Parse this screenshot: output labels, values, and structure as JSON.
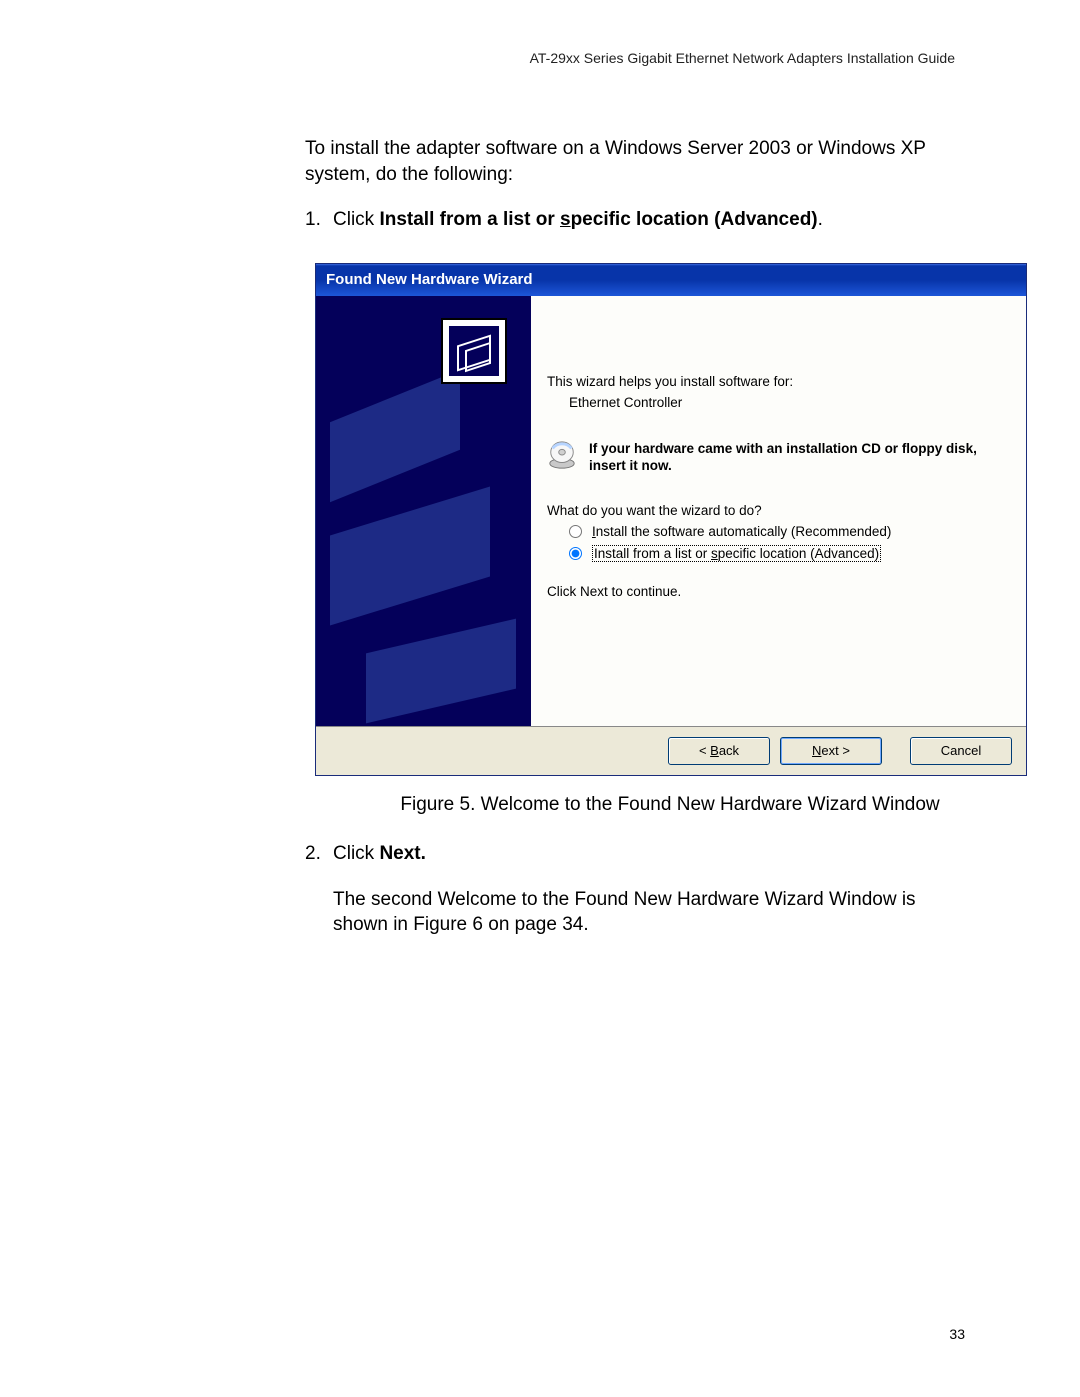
{
  "doc_header": "AT-29xx Series Gigabit Ethernet Network Adapters Installation Guide",
  "intro": "To install the adapter software on a Windows Server 2003 or Windows XP system, do the following:",
  "step1": {
    "num": "1.",
    "prefix": "Click ",
    "bold_a": "Install from a list or ",
    "bold_u": "s",
    "bold_b": "pecific location (Advanced)",
    "suffix": "."
  },
  "dialog": {
    "title": "Found New Hardware Wizard",
    "line1": "This wizard helps you install software for:",
    "device": "Ethernet Controller",
    "cd_text": "If your hardware came with an installation CD or floppy disk, insert it now.",
    "prompt": "What do you want the wizard to do?",
    "radio1_a": "I",
    "radio1_b": "nstall the software automatically (Recommended)",
    "radio2_a": "Install from a list or ",
    "radio2_u": "s",
    "radio2_b": "pecific location (Advanced)",
    "continue": "Click Next to continue.",
    "buttons": {
      "back_lt": "< ",
      "back_u": "B",
      "back_rest": "ack",
      "next_u": "N",
      "next_rest": "ext >",
      "cancel": "Cancel"
    }
  },
  "fig_caption": "Figure 5. Welcome to the Found New Hardware Wizard Window",
  "step2": {
    "num": "2.",
    "prefix": "Click ",
    "bold": "Next."
  },
  "follow": "The second Welcome to the Found New Hardware Wizard Window is shown in Figure 6 on page 34.",
  "page_num": "33"
}
